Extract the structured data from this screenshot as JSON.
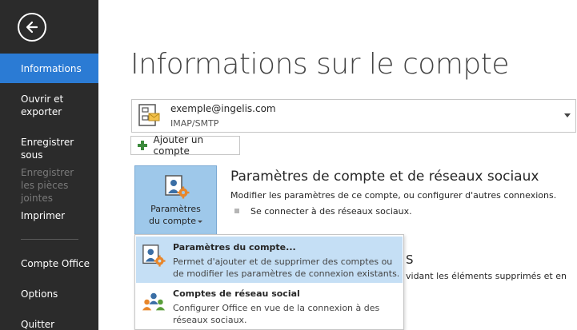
{
  "sidebar": {
    "items": [
      {
        "label": "Informations",
        "state": "active"
      },
      {
        "label": "Ouvrir et exporter",
        "state": "normal"
      },
      {
        "label": "Enregistrer sous",
        "state": "normal"
      },
      {
        "label": "Enregistrer les pièces jointes",
        "state": "disabled"
      },
      {
        "label": "Imprimer",
        "state": "normal"
      },
      {
        "label": "Compte Office",
        "state": "normal"
      },
      {
        "label": "Options",
        "state": "normal"
      },
      {
        "label": "Quitter",
        "state": "normal"
      }
    ]
  },
  "main": {
    "title": "Informations sur le compte",
    "account": {
      "email": "exemple@ingelis.com",
      "type": "IMAP/SMTP"
    },
    "add_account_label": "Ajouter un compte",
    "tile_label_line1": "Paramètres",
    "tile_label_line2": "du compte",
    "section": {
      "heading": "Paramètres de compte et de réseaux sociaux",
      "description": "Modifier les paramètres de ce compte, ou configurer d'autres connexions.",
      "bullet": "Se connecter à des réseaux sociaux."
    },
    "hidden_section": {
      "heading_tail": "S",
      "description_tail": "vidant les éléments supprimés et en"
    }
  },
  "dropdown": {
    "items": [
      {
        "title": "Paramètres du compte...",
        "description": "Permet d'ajouter et de supprimer des comptes ou de modifier les paramètres de connexion existants."
      },
      {
        "title": "Comptes de réseau social",
        "description": "Configurer Office en vue de la connexion à des réseaux sociaux."
      }
    ]
  },
  "colors": {
    "sidebar_bg": "#2b2b2b",
    "active_nav": "#2b7bd4",
    "tile_bg": "#9ec8ea",
    "menu_highlight": "#c5dff5"
  },
  "icons": {
    "back": "back-arrow-icon",
    "account": "mail-account-icon",
    "add": "plus-icon",
    "settings": "account-settings-icon",
    "social": "social-network-icon"
  }
}
